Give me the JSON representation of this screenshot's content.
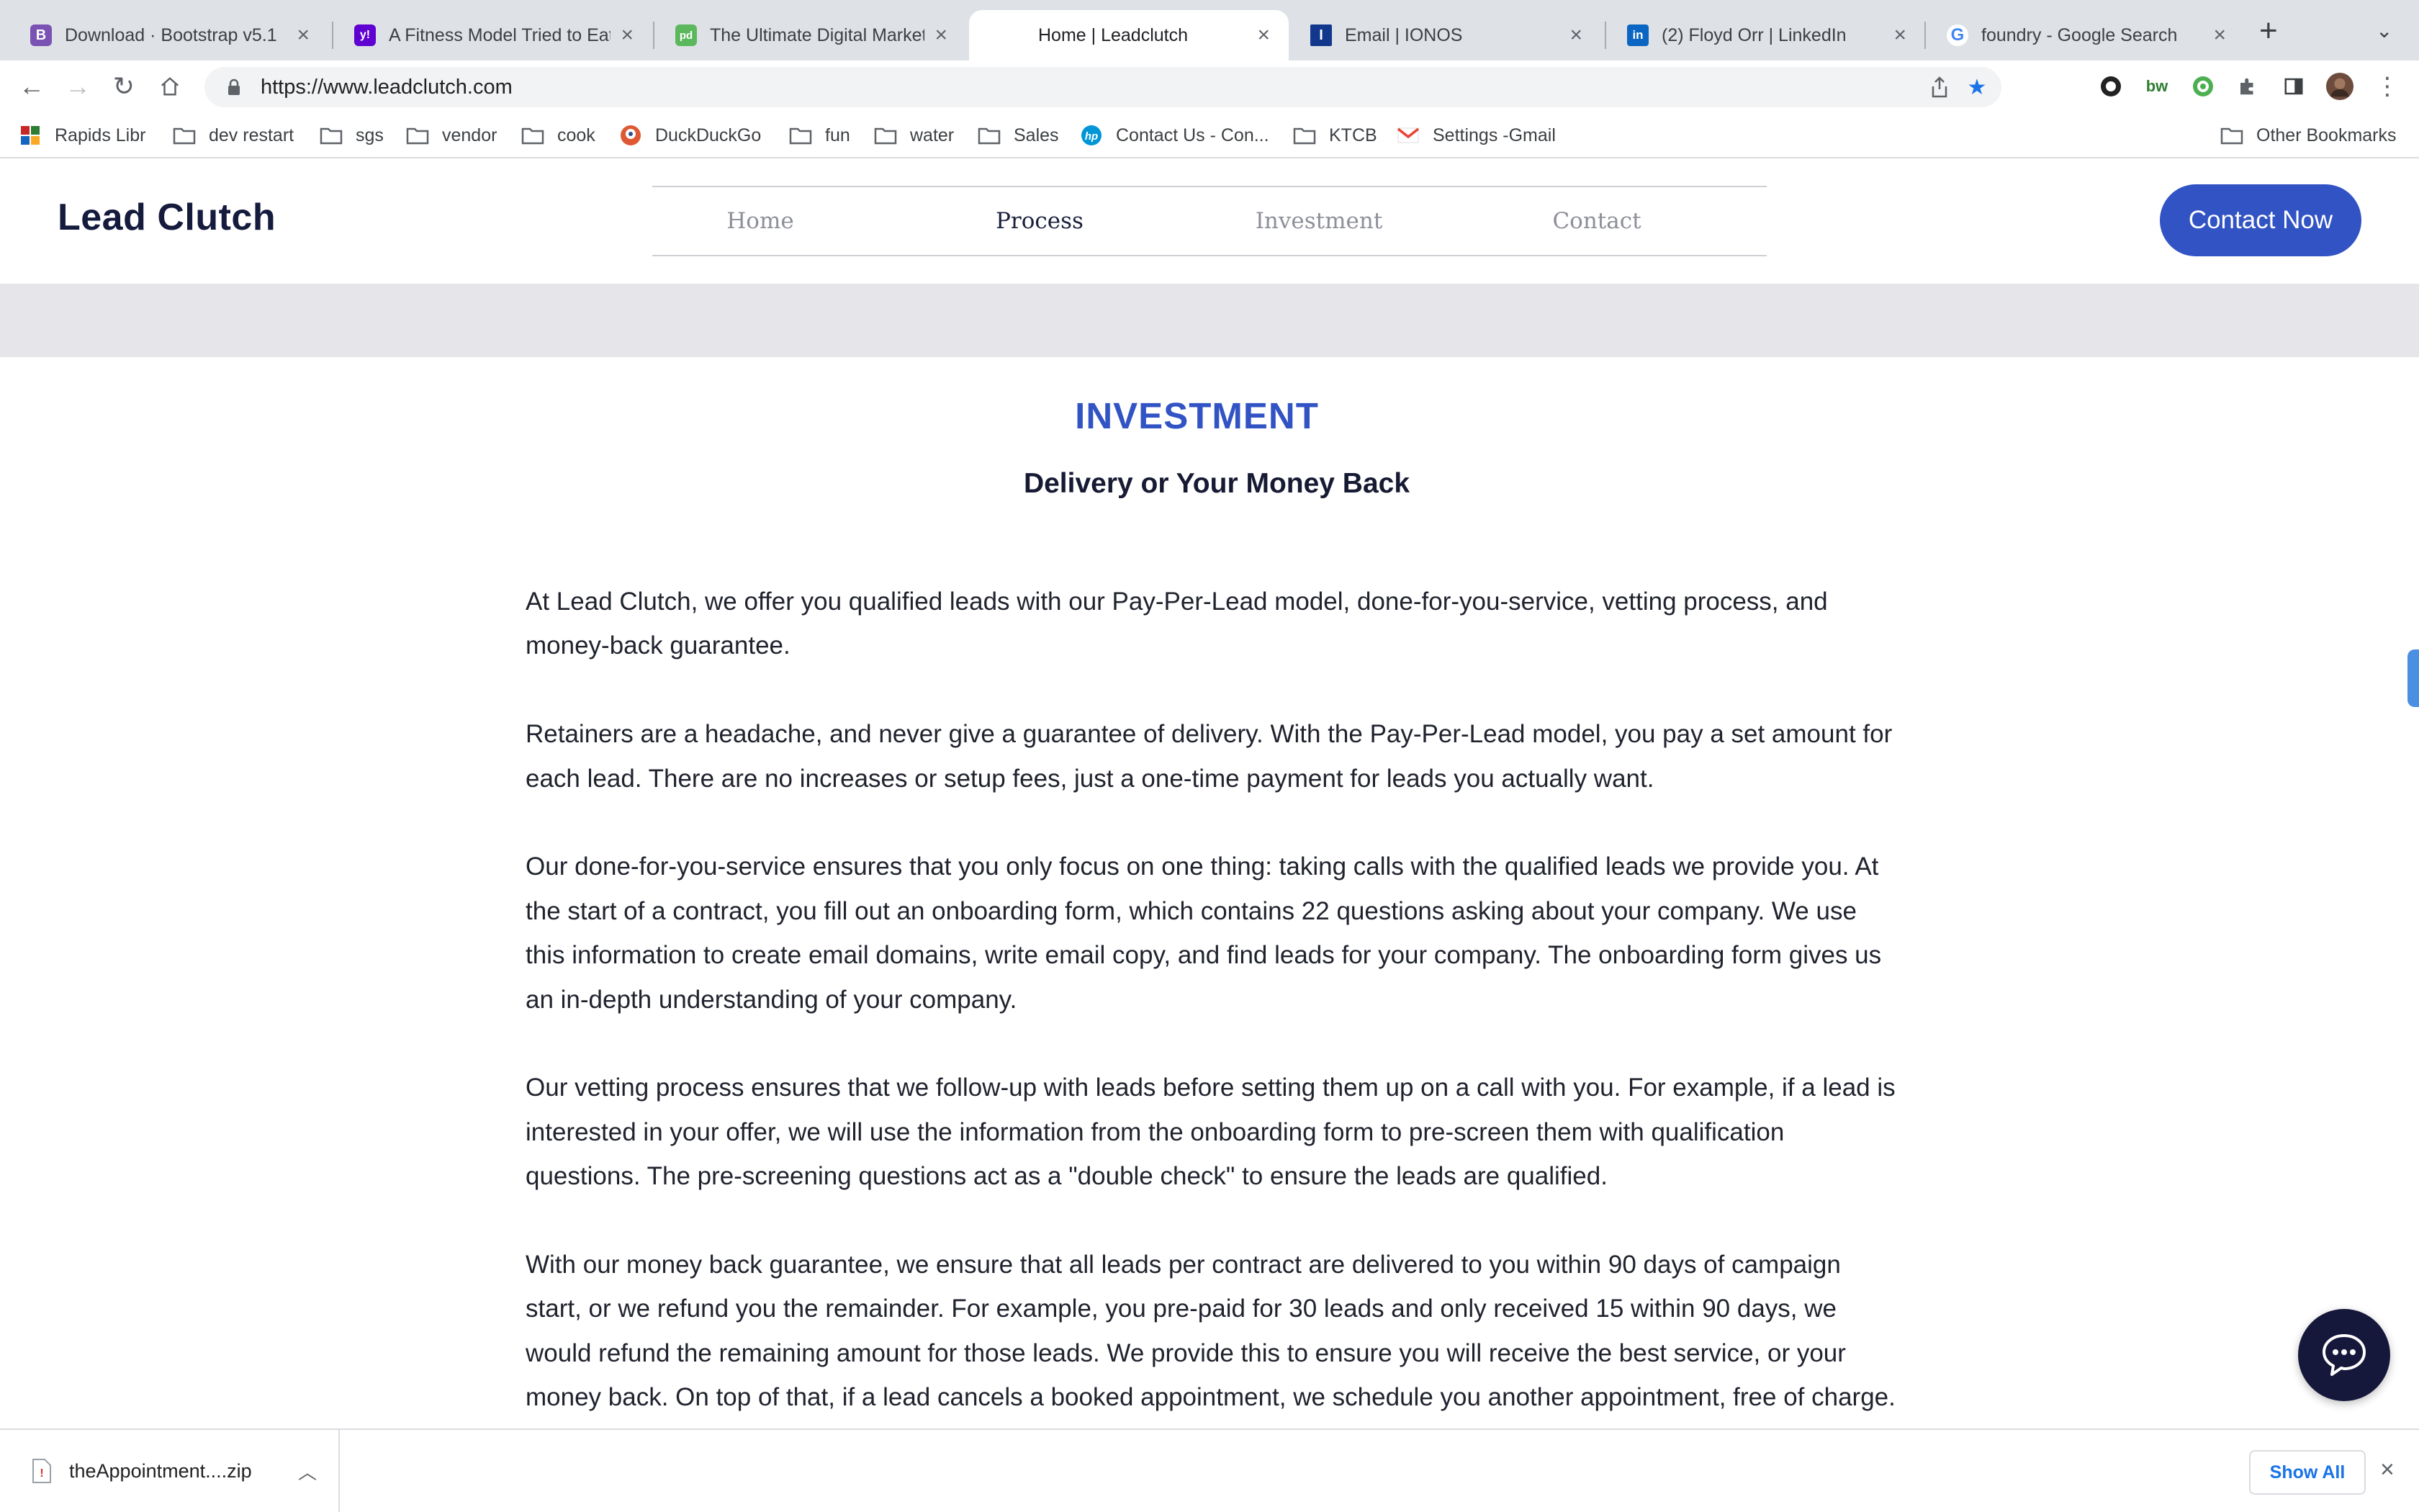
{
  "browser": {
    "tabs": [
      {
        "title": "Download · Bootstrap v5.1",
        "favicon": "bootstrap-icon",
        "color": "#7952b3",
        "glyph": "B",
        "active": false
      },
      {
        "title": "A Fitness Model Tried to Eat",
        "favicon": "yahoo-icon",
        "color": "#5f01d1",
        "glyph": "y!",
        "active": false
      },
      {
        "title": "The Ultimate Digital Marketing",
        "favicon": "pd-icon",
        "color": "#5cb85c",
        "glyph": "pd",
        "active": false
      },
      {
        "title": "Home | Leadclutch",
        "favicon": "none",
        "color": "#ffffff",
        "glyph": "",
        "active": true
      },
      {
        "title": "Email | IONOS",
        "favicon": "ionos-icon",
        "color": "#11388c",
        "glyph": "I",
        "active": false
      },
      {
        "title": "(2) Floyd Orr | LinkedIn",
        "favicon": "linkedin-icon",
        "color": "#0a66c2",
        "glyph": "in",
        "active": false
      },
      {
        "title": "foundry - Google Search",
        "favicon": "google-icon",
        "color": "#4285f4",
        "glyph": "G",
        "active": false
      }
    ],
    "url": "https://www.leadclutch.com",
    "bookmarks": [
      {
        "label": "Rapids Libr",
        "icon": "library-icon"
      },
      {
        "label": "dev restart",
        "icon": "folder-icon"
      },
      {
        "label": "sgs",
        "icon": "folder-icon"
      },
      {
        "label": "vendor",
        "icon": "folder-icon"
      },
      {
        "label": "cook",
        "icon": "folder-icon"
      },
      {
        "label": "DuckDuckGo",
        "icon": "duckduckgo-icon"
      },
      {
        "label": "fun",
        "icon": "folder-icon"
      },
      {
        "label": "water",
        "icon": "folder-icon"
      },
      {
        "label": "Sales",
        "icon": "folder-icon"
      },
      {
        "label": "Contact Us - Con...",
        "icon": "hp-icon"
      },
      {
        "label": "KTCB",
        "icon": "folder-icon"
      },
      {
        "label": "Settings -Gmail",
        "icon": "gmail-icon"
      }
    ],
    "other_bookmarks": "Other Bookmarks"
  },
  "site": {
    "brand": "Lead Clutch",
    "nav": [
      {
        "label": "Home",
        "current": false
      },
      {
        "label": "Process",
        "current": true
      },
      {
        "label": "Investment",
        "current": false
      },
      {
        "label": "Contact",
        "current": false
      }
    ],
    "cta_label": "Contact Now",
    "accent_color": "#3153c4"
  },
  "section": {
    "eyebrow": "INVESTMENT",
    "subtitle": "Delivery or Your Money Back",
    "paragraphs": [
      "At Lead Clutch, we offer you qualified leads with our Pay-Per-Lead model, done-for-you-service, vetting process, and money-back guarantee.",
      "Retainers are a headache, and never give a guarantee of delivery. With the Pay-Per-Lead model, you pay a set amount for each lead. There are no increases or setup fees, just a one-time payment for leads you actually want.",
      "Our done-for-you-service ensures that you only focus on one thing: taking calls with the qualified leads we provide you. At the start of a contract, you fill out an onboarding form, which contains 22 questions asking about your company. We use this information to create email domains, write email copy, and find leads for your company. The onboarding form gives us an in-depth understanding of your company.",
      "Our vetting process ensures that we follow-up with leads before setting them up on a call with you. For example, if a lead is interested in your offer, we will use the information from the onboarding form to pre-screen them with qualification questions. The pre-screening questions act as a \"double check\" to ensure the leads are qualified.",
      "With our money back guarantee, we ensure that all leads per contract are delivered to you within 90 days of campaign start, or we refund you the remainder. For example, you pre-paid for 30 leads and only received 15 within 90 days, we would refund the remaining amount for those leads. We provide this to ensure you will receive the best service, or your money back. On top of that, if a lead cancels a booked appointment, we schedule you another appointment, free of charge."
    ]
  },
  "downloads": {
    "file_name": "theAppointment....zip",
    "show_all": "Show All"
  }
}
